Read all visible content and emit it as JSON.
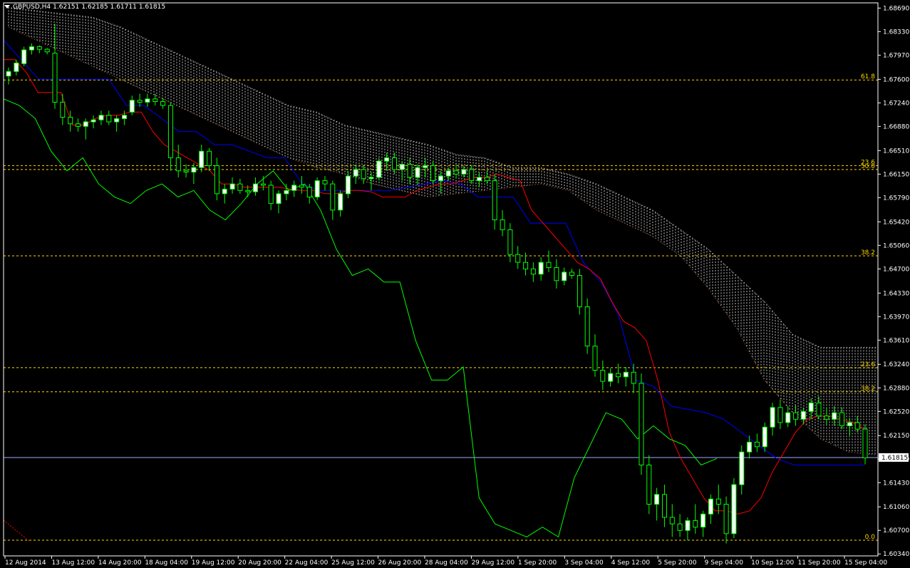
{
  "header": {
    "symbol": "GBPUSD,H4",
    "open": "1.62151",
    "high": "1.62185",
    "low": "1.61711",
    "close": "1.61815"
  },
  "colors": {
    "background": "#000000",
    "axis": "#ffffff",
    "bull_candle": "#ffffff",
    "bear_candle": "#000000",
    "candle_outline": "#00ff00",
    "tenkan": "#ff0000",
    "kijun": "#0000ff",
    "chikou": "#00ff00",
    "kumo": "#ffffff",
    "fibo": "#ffd700",
    "price_line": "#a0a8ff"
  },
  "chart_data": {
    "type": "candlestick",
    "title": "GBPUSD,H4",
    "ylim": [
      1.6031,
      1.6877
    ],
    "y_ticks": [
      "1.68690",
      "1.68330",
      "1.67970",
      "1.67600",
      "1.67240",
      "1.66880",
      "1.66510",
      "1.66150",
      "1.65790",
      "1.65420",
      "1.65060",
      "1.64700",
      "1.64330",
      "1.63970",
      "1.63610",
      "1.63240",
      "1.62880",
      "1.62520",
      "1.62150",
      "1.61790",
      "1.61430",
      "1.61060",
      "1.60700",
      "1.60340"
    ],
    "x_ticks": [
      "12 Aug 2014",
      "13 Aug 12:00",
      "14 Aug 20:00",
      "18 Aug 04:00",
      "19 Aug 12:00",
      "20 Aug 20:00",
      "22 Aug 04:00",
      "25 Aug 12:00",
      "26 Aug 20:00",
      "28 Aug 04:00",
      "29 Aug 12:00",
      "1 Sep 20:00",
      "3 Sep 04:00",
      "4 Sep 12:00",
      "5 Sep 20:00",
      "9 Sep 04:00",
      "10 Sep 12:00",
      "11 Sep 20:00",
      "15 Sep 04:00"
    ],
    "current_price": "1.61815",
    "fibo_levels": [
      {
        "label": "61.8",
        "value": 1.6759
      },
      {
        "label": "23.6",
        "value": 1.6628
      },
      {
        "label": "50.0",
        "value": 1.6622
      },
      {
        "label": "38.2",
        "value": 1.649
      },
      {
        "label": "23.6",
        "value": 1.6319
      },
      {
        "label": "38.2",
        "value": 1.6282
      },
      {
        "label": "0.0",
        "value": 1.6055
      }
    ],
    "candles": [
      [
        1.6765,
        1.6778,
        1.6752,
        1.6772
      ],
      [
        1.6772,
        1.679,
        1.6766,
        1.6785
      ],
      [
        1.6784,
        1.681,
        1.678,
        1.6805
      ],
      [
        1.6805,
        1.6815,
        1.6798,
        1.681
      ],
      [
        1.681,
        1.6812,
        1.68,
        1.6806
      ],
      [
        1.6806,
        1.6808,
        1.6798,
        1.6802
      ],
      [
        1.68,
        1.6845,
        1.6715,
        1.6725
      ],
      [
        1.6725,
        1.6738,
        1.669,
        1.6702
      ],
      [
        1.6702,
        1.6712,
        1.668,
        1.6692
      ],
      [
        1.6692,
        1.67,
        1.668,
        1.6688
      ],
      [
        1.6688,
        1.67,
        1.6668,
        1.6695
      ],
      [
        1.6695,
        1.6705,
        1.6685,
        1.6698
      ],
      [
        1.6698,
        1.6712,
        1.669,
        1.6705
      ],
      [
        1.6705,
        1.6712,
        1.669,
        1.6695
      ],
      [
        1.6695,
        1.6705,
        1.668,
        1.67
      ],
      [
        1.67,
        1.6712,
        1.669,
        1.6705
      ],
      [
        1.671,
        1.6735,
        1.6705,
        1.6728
      ],
      [
        1.6728,
        1.6738,
        1.6718,
        1.6725
      ],
      [
        1.6725,
        1.6738,
        1.6718,
        1.673
      ],
      [
        1.673,
        1.6738,
        1.672,
        1.6726
      ],
      [
        1.6726,
        1.6732,
        1.6715,
        1.672
      ],
      [
        1.672,
        1.6725,
        1.662,
        1.664
      ],
      [
        1.664,
        1.666,
        1.661,
        1.662
      ],
      [
        1.662,
        1.663,
        1.661,
        1.6618
      ],
      [
        1.6618,
        1.6632,
        1.66,
        1.6625
      ],
      [
        1.6625,
        1.666,
        1.6618,
        1.665
      ],
      [
        1.665,
        1.6655,
        1.662,
        1.6628
      ],
      [
        1.6628,
        1.664,
        1.6575,
        1.6585
      ],
      [
        1.6585,
        1.66,
        1.657,
        1.6592
      ],
      [
        1.6592,
        1.661,
        1.6585,
        1.66
      ],
      [
        1.66,
        1.6608,
        1.6585,
        1.659
      ],
      [
        1.659,
        1.6598,
        1.658,
        1.6588
      ],
      [
        1.6588,
        1.661,
        1.6582,
        1.66
      ],
      [
        1.66,
        1.6612,
        1.659,
        1.6598
      ],
      [
        1.6598,
        1.6605,
        1.656,
        1.657
      ],
      [
        1.657,
        1.659,
        1.6555,
        1.6585
      ],
      [
        1.6585,
        1.66,
        1.6575,
        1.659
      ],
      [
        1.659,
        1.6605,
        1.658,
        1.6598
      ],
      [
        1.6598,
        1.6612,
        1.6585,
        1.6595
      ],
      [
        1.6595,
        1.66,
        1.657,
        1.658
      ],
      [
        1.658,
        1.661,
        1.6575,
        1.6605
      ],
      [
        1.6605,
        1.6612,
        1.659,
        1.66
      ],
      [
        1.66,
        1.6605,
        1.6545,
        1.656
      ],
      [
        1.656,
        1.659,
        1.655,
        1.6585
      ],
      [
        1.6585,
        1.662,
        1.6578,
        1.6612
      ],
      [
        1.6612,
        1.663,
        1.66,
        1.6622
      ],
      [
        1.6622,
        1.6628,
        1.66,
        1.6608
      ],
      [
        1.6608,
        1.6618,
        1.659,
        1.661
      ],
      [
        1.661,
        1.664,
        1.6605,
        1.6635
      ],
      [
        1.6635,
        1.6648,
        1.662,
        1.664
      ],
      [
        1.664,
        1.6648,
        1.6615,
        1.6622
      ],
      [
        1.6622,
        1.6635,
        1.6605,
        1.663
      ],
      [
        1.663,
        1.664,
        1.66,
        1.661
      ],
      [
        1.661,
        1.663,
        1.6598,
        1.6625
      ],
      [
        1.6625,
        1.664,
        1.661,
        1.6628
      ],
      [
        1.6628,
        1.6635,
        1.66,
        1.6605
      ],
      [
        1.6605,
        1.662,
        1.6585,
        1.6612
      ],
      [
        1.6612,
        1.6625,
        1.6605,
        1.662
      ],
      [
        1.662,
        1.663,
        1.6608,
        1.6615
      ],
      [
        1.6615,
        1.6628,
        1.661,
        1.6622
      ],
      [
        1.6622,
        1.6628,
        1.66,
        1.6605
      ],
      [
        1.6605,
        1.6618,
        1.6595,
        1.661
      ],
      [
        1.661,
        1.662,
        1.66,
        1.6605
      ],
      [
        1.6605,
        1.6615,
        1.653,
        1.6545
      ],
      [
        1.6545,
        1.656,
        1.652,
        1.653
      ],
      [
        1.653,
        1.654,
        1.648,
        1.6492
      ],
      [
        1.6492,
        1.6505,
        1.647,
        1.648
      ],
      [
        1.648,
        1.6495,
        1.646,
        1.647
      ],
      [
        1.647,
        1.648,
        1.645,
        1.6462
      ],
      [
        1.6462,
        1.6488,
        1.6452,
        1.648
      ],
      [
        1.648,
        1.6498,
        1.6465,
        1.6472
      ],
      [
        1.6472,
        1.6485,
        1.644,
        1.6452
      ],
      [
        1.6452,
        1.6472,
        1.6445,
        1.6465
      ],
      [
        1.6465,
        1.647,
        1.6455,
        1.646
      ],
      [
        1.646,
        1.647,
        1.64,
        1.6412
      ],
      [
        1.6412,
        1.6425,
        1.634,
        1.6352
      ],
      [
        1.6352,
        1.637,
        1.6305,
        1.6315
      ],
      [
        1.6315,
        1.633,
        1.6285,
        1.6298
      ],
      [
        1.6298,
        1.6318,
        1.629,
        1.631
      ],
      [
        1.631,
        1.6325,
        1.6295,
        1.6305
      ],
      [
        1.6305,
        1.632,
        1.629,
        1.6312
      ],
      [
        1.6312,
        1.6325,
        1.628,
        1.6295
      ],
      [
        1.6295,
        1.631,
        1.6155,
        1.617
      ],
      [
        1.617,
        1.6185,
        1.6095,
        1.611
      ],
      [
        1.611,
        1.6135,
        1.6085,
        1.6125
      ],
      [
        1.6125,
        1.614,
        1.6075,
        1.609
      ],
      [
        1.609,
        1.611,
        1.606,
        1.608
      ],
      [
        1.608,
        1.6095,
        1.606,
        1.607
      ],
      [
        1.607,
        1.609,
        1.6055,
        1.6085
      ],
      [
        1.6085,
        1.611,
        1.6065,
        1.6075
      ],
      [
        1.6075,
        1.61,
        1.606,
        1.6095
      ],
      [
        1.6095,
        1.6125,
        1.608,
        1.6118
      ],
      [
        1.6118,
        1.614,
        1.6095,
        1.611
      ],
      [
        1.611,
        1.6122,
        1.605,
        1.6065
      ],
      [
        1.6065,
        1.615,
        1.6058,
        1.614
      ],
      [
        1.614,
        1.62,
        1.6125,
        1.619
      ],
      [
        1.619,
        1.6215,
        1.618,
        1.6205
      ],
      [
        1.6205,
        1.6218,
        1.619,
        1.6198
      ],
      [
        1.6198,
        1.6235,
        1.619,
        1.6228
      ],
      [
        1.6228,
        1.6265,
        1.6215,
        1.6258
      ],
      [
        1.6258,
        1.627,
        1.6225,
        1.6235
      ],
      [
        1.6235,
        1.626,
        1.6228,
        1.625
      ],
      [
        1.625,
        1.6262,
        1.623,
        1.624
      ],
      [
        1.624,
        1.6258,
        1.6232,
        1.6252
      ],
      [
        1.6252,
        1.6272,
        1.624,
        1.6265
      ],
      [
        1.6265,
        1.6275,
        1.624,
        1.6245
      ],
      [
        1.6245,
        1.6258,
        1.6232,
        1.624
      ],
      [
        1.624,
        1.626,
        1.623,
        1.625
      ],
      [
        1.625,
        1.6258,
        1.6225,
        1.623
      ],
      [
        1.623,
        1.6242,
        1.6215,
        1.6235
      ],
      [
        1.6235,
        1.6245,
        1.622,
        1.6225
      ],
      [
        1.6225,
        1.6232,
        1.6171,
        1.6181
      ]
    ],
    "tenkan": [
      1.679,
      1.679,
      1.677,
      1.674,
      1.674,
      1.674,
      1.669,
      1.669,
      1.67,
      1.6705,
      1.6705,
      1.671,
      1.671,
      1.668,
      1.666,
      1.665,
      1.664,
      1.663,
      1.662,
      1.66,
      1.66,
      1.6595,
      1.6595,
      1.6595,
      1.6595,
      1.6592,
      1.659,
      1.659,
      1.6585,
      1.6585,
      1.659,
      1.659,
      1.6588,
      1.658,
      1.658,
      1.658,
      1.659,
      1.6595,
      1.66,
      1.66,
      1.6605,
      1.661,
      1.661,
      1.6615,
      1.661,
      1.6605,
      1.656,
      1.654,
      1.652,
      1.65,
      1.648,
      1.647,
      1.6455,
      1.642,
      1.639,
      1.638,
      1.636,
      1.63,
      1.622,
      1.618,
      1.615,
      1.612,
      1.61,
      1.61,
      1.6095,
      1.61,
      1.612,
      1.616,
      1.619,
      1.622,
      1.624,
      1.6245,
      1.6245,
      1.624,
      1.6235,
      1.6225
    ],
    "kijun": [
      1.682,
      1.679,
      1.676,
      1.676,
      1.676,
      1.676,
      1.676,
      1.672,
      1.672,
      1.67,
      1.668,
      1.668,
      1.666,
      1.666,
      1.665,
      1.664,
      1.664,
      1.66,
      1.659,
      1.659,
      1.659,
      1.659,
      1.659,
      1.6595,
      1.66,
      1.6605,
      1.66,
      1.658,
      1.658,
      1.658,
      1.654,
      1.654,
      1.654,
      1.648,
      1.645,
      1.64,
      1.63,
      1.629,
      1.626,
      1.6255,
      1.625,
      1.624,
      1.622,
      1.62,
      1.618,
      1.617,
      1.617,
      1.617,
      1.617,
      1.617
    ],
    "chikou": [
      1.673,
      1.672,
      1.67,
      1.665,
      1.662,
      1.664,
      1.66,
      1.658,
      1.657,
      1.659,
      1.66,
      1.658,
      1.659,
      1.656,
      1.6545,
      1.657,
      1.66,
      1.662,
      1.659,
      1.66,
      1.656,
      1.65,
      1.646,
      1.647,
      1.645,
      1.645,
      1.636,
      1.63,
      1.63,
      1.632,
      1.612,
      1.608,
      1.607,
      1.606,
      1.6075,
      1.606,
      1.615,
      1.62,
      1.625,
      1.624,
      1.621,
      1.623,
      1.621,
      1.62,
      1.617,
      1.618
    ],
    "kumo_top": [
      1.687,
      1.6865,
      1.686,
      1.6855,
      1.684,
      1.682,
      1.68,
      1.678,
      1.676,
      1.674,
      1.672,
      1.671,
      1.669,
      1.668,
      1.667,
      1.666,
      1.6645,
      1.664,
      1.6625,
      1.6625,
      1.6615,
      1.66,
      1.658,
      1.656,
      1.653,
      1.65,
      1.646,
      1.642,
      1.637,
      1.635,
      1.635,
      1.635
    ],
    "kumo_bottom": [
      1.684,
      1.682,
      1.68,
      1.678,
      1.676,
      1.674,
      1.672,
      1.67,
      1.668,
      1.666,
      1.664,
      1.6625,
      1.6615,
      1.66,
      1.659,
      1.658,
      1.6585,
      1.659,
      1.6595,
      1.66,
      1.659,
      1.656,
      1.654,
      1.652,
      1.649,
      1.644,
      1.638,
      1.63,
      1.625,
      1.621,
      1.619,
      1.6185
    ]
  }
}
